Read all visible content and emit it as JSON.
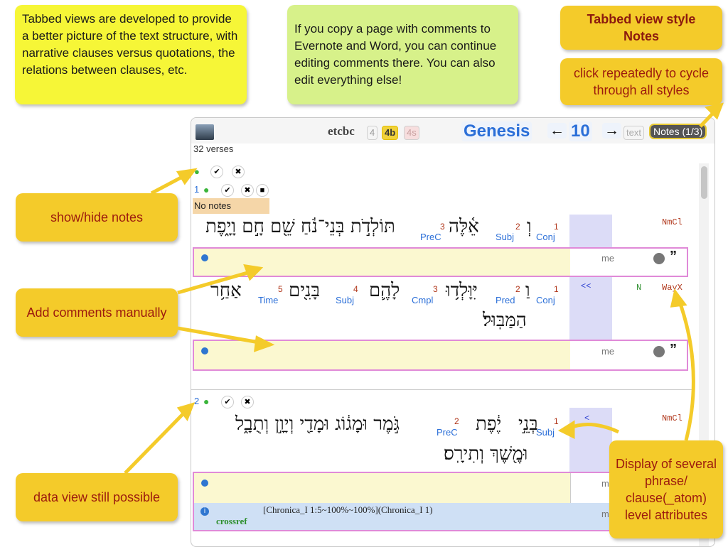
{
  "callouts": {
    "tabbed_views": "Tabbed views are developed to provide a better picture of the text structure, with narrative clauses versus quotations, the relations between clauses, etc.",
    "copy_page": "If you copy a page with comments to Evernote and Word, you can continue editing comments there. You can also edit everything else!",
    "style_title_line1": "Tabbed view style",
    "style_title_line2": "Notes",
    "click_cycle": "click repeatedly to cycle through all styles",
    "show_hide": "show/hide notes",
    "add_comments": "Add comments manually",
    "data_view": "data view still possible",
    "display_attrs": "Display of several phrase/ clause(_atom) level attributes"
  },
  "header": {
    "source": "etcbc",
    "v4": "4",
    "v4b": "4b",
    "v4s": "4s",
    "book": "Genesis",
    "prev": "←",
    "chapter": "10",
    "next": "→",
    "text_tab": "text",
    "notes_tab": "Notes (1/3)",
    "verse_count": "32 verses"
  },
  "no_notes": "No notes",
  "verse1": {
    "number": "1",
    "clause1": {
      "hebrew_conj": "וְ",
      "hebrew_subj": "אֵ֫לֶּה",
      "hebrew_pred": "תּוֹלְדֹ֣ת בְּנֵי־נֹ֔חַ שֵׁ֖ם חָ֣ם וָיָ֑פֶת",
      "p1": "1",
      "p1_label": "Conj",
      "p2": "2",
      "p2_label": "Subj",
      "p3": "3",
      "p3_label": "PreC",
      "type": "NmCl"
    },
    "clause2": {
      "hebrew_conj": "וַ",
      "hebrew_pred": "יִּוָּלְד֥וּ",
      "hebrew_cmpl": "לָהֶ֛ם",
      "hebrew_subj": "בָּנִ֖ים",
      "hebrew_time": "אַחַ֥ר",
      "hebrew_cont": "הַמַּבּֽוּל׃",
      "p1": "1",
      "p1_label": "Conj",
      "p2": "2",
      "p2_label": "Pred",
      "p3": "3",
      "p3_label": "Cmpl",
      "p4": "4",
      "p4_label": "Subj",
      "p5": "5",
      "p5_label": "Time",
      "rel": "<<",
      "n": "N",
      "type": "WayX"
    },
    "me": "me"
  },
  "verse2": {
    "number": "2",
    "hebrew_subj": "בְּנֵ֣י",
    "hebrew_name": "יֶ֔פֶת",
    "hebrew_pred": "גֹּ֣מֶר וּמָג֔וֹג וּמָדַ֖י וְיָוָ֣ן וְתֻבָ֑ל",
    "hebrew_cont": "וּמֶ֖שֶׁךְ וְתִירָֽס׃",
    "p1": "1",
    "p1_label": "Subj",
    "p2": "2",
    "p2_label": "PreC",
    "rel": "<",
    "type": "NmCl",
    "crossref_text": "[Chronica_I 1:5~100%~100%](Chronica_I 1)",
    "crossref_label": "crossref",
    "me": "me"
  },
  "colors": {
    "accent_blue": "#2b6fd8",
    "pink_border": "#e08ad8",
    "cell_yellow": "#fbf8d0"
  }
}
